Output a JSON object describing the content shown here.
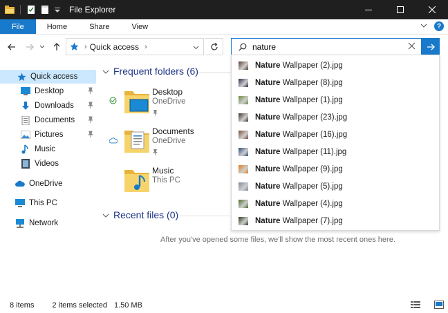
{
  "window": {
    "title": "File Explorer"
  },
  "ribbon": {
    "tabs": [
      "File",
      "Home",
      "Share",
      "View"
    ]
  },
  "address": {
    "location": "Quick access"
  },
  "search": {
    "value": "nature",
    "placeholder": ""
  },
  "nav": {
    "quick_access": "Quick access",
    "pinned": [
      "Desktop",
      "Downloads",
      "Documents",
      "Pictures"
    ],
    "unpinned": [
      "Music",
      "Videos"
    ],
    "onedrive": "OneDrive",
    "thispc": "This PC",
    "network": "Network"
  },
  "frequent": {
    "heading": "Frequent folders (6)",
    "folders": [
      {
        "name": "Desktop",
        "location": "OneDrive"
      },
      {
        "name": "Documents",
        "location": "OneDrive"
      },
      {
        "name": "Music",
        "location": "This PC"
      }
    ]
  },
  "recent": {
    "heading": "Recent files (0)",
    "empty_message": "After you've opened some files, we'll show the most recent ones here."
  },
  "suggestions": {
    "match": "Nature",
    "items": [
      " Wallpaper (2).jpg",
      " Wallpaper (8).jpg",
      " Wallpaper (1).jpg",
      " Wallpaper (23).jpg",
      " Wallpaper (16).jpg",
      " Wallpaper (11).jpg",
      " Wallpaper (9).jpg",
      " Wallpaper (5).jpg",
      " Wallpaper (4).jpg",
      " Wallpaper (7).jpg"
    ],
    "thumb_colors": [
      "#5b3a28",
      "#2d2a4a",
      "#6a8a3a",
      "#3a2f22",
      "#7a4a3a",
      "#2a4a7a",
      "#e07a1a",
      "#7a8a9a",
      "#4a6a2a",
      "#2a3a1a"
    ]
  },
  "status": {
    "items": "8 items",
    "selected": "2 items selected",
    "size": "1.50 MB"
  },
  "colors": {
    "accent": "#1979ca",
    "heading": "#1e3287",
    "selection": "#cce8ff"
  }
}
